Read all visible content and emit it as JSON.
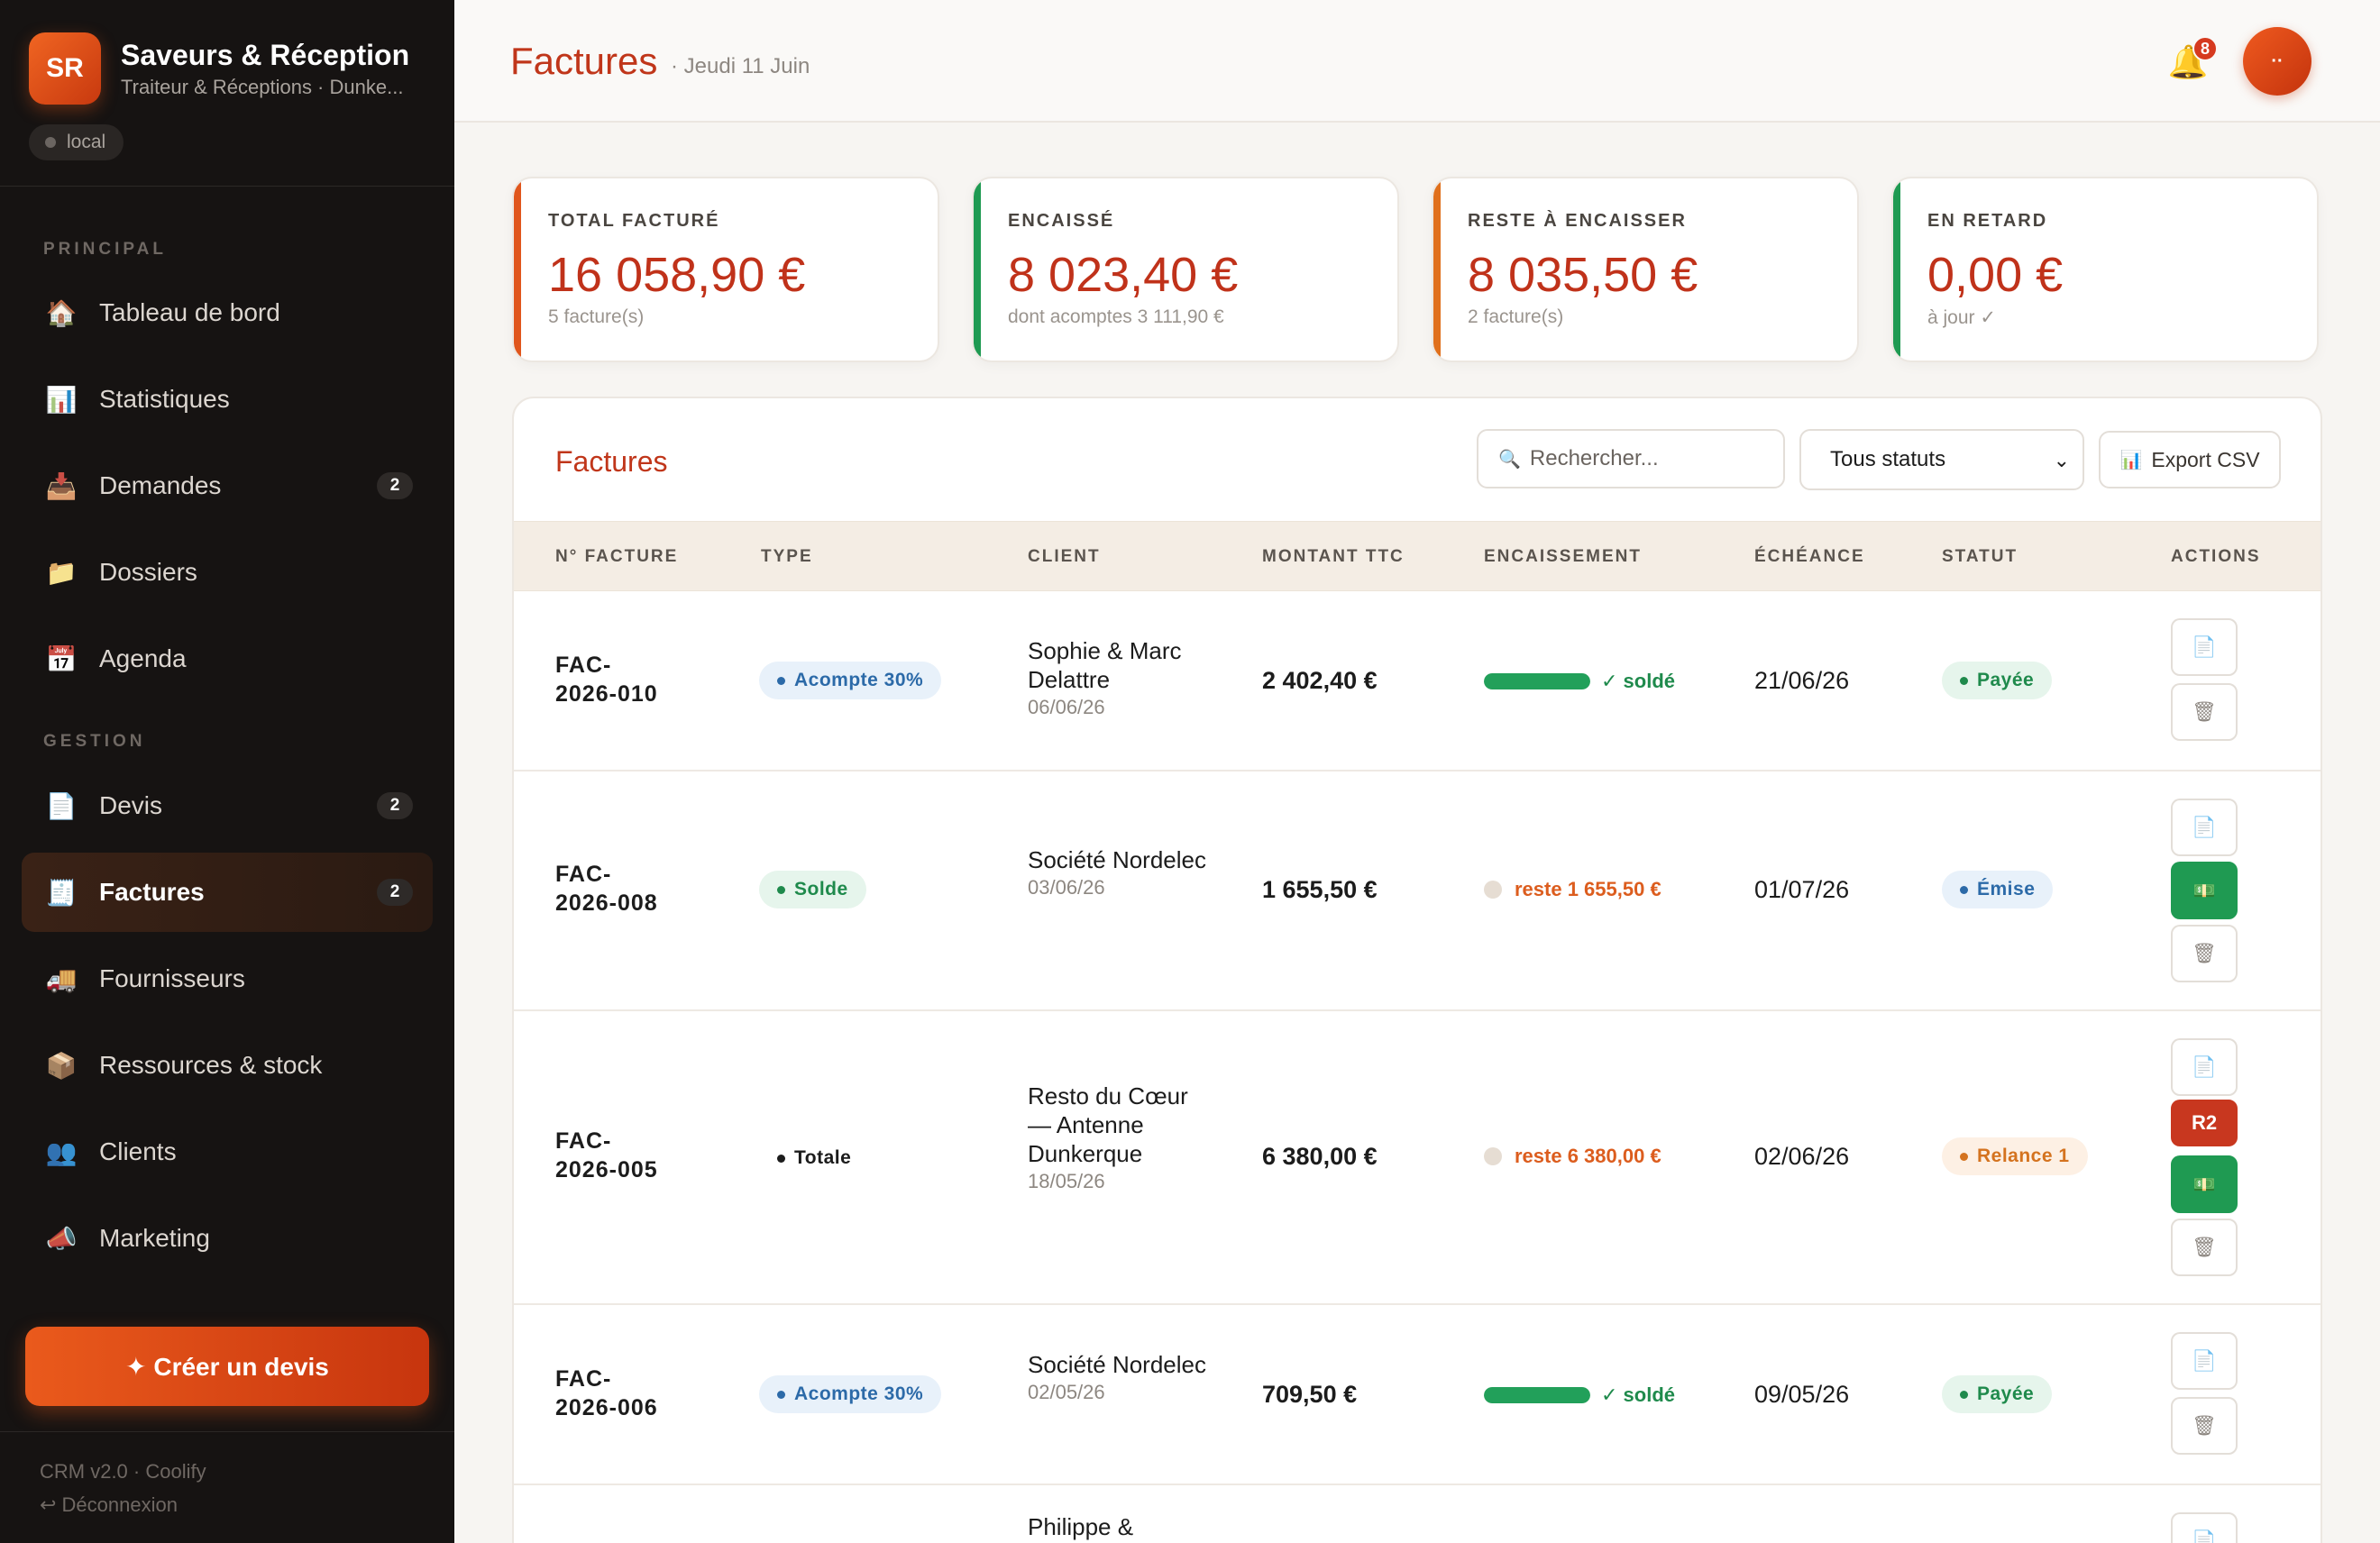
{
  "brand": {
    "logo": "SR",
    "title": "Saveurs & Réception",
    "subtitle": "Traiteur & Réceptions · Dunke...",
    "env": "local"
  },
  "sidebar": {
    "section_principal": "PRINCIPAL",
    "section_gestion": "GESTION",
    "items": [
      {
        "label": "Tableau de bord",
        "icon": "🏠",
        "badge": ""
      },
      {
        "label": "Statistiques",
        "icon": "📊",
        "badge": ""
      },
      {
        "label": "Demandes",
        "icon": "📥",
        "badge": "2"
      },
      {
        "label": "Dossiers",
        "icon": "📁",
        "badge": ""
      },
      {
        "label": "Agenda",
        "icon": "📅",
        "badge": ""
      },
      {
        "label": "Devis",
        "icon": "📄",
        "badge": "2"
      },
      {
        "label": "Factures",
        "icon": "🧾",
        "badge": "2"
      },
      {
        "label": "Fournisseurs",
        "icon": "🚚",
        "badge": ""
      },
      {
        "label": "Ressources & stock",
        "icon": "📦",
        "badge": ""
      },
      {
        "label": "Clients",
        "icon": "👥",
        "badge": ""
      },
      {
        "label": "Marketing",
        "icon": "📣",
        "badge": ""
      }
    ],
    "create_label": "✦ Créer un devis",
    "footer_version": "CRM v2.0 · Coolify",
    "footer_logout": "↩ Déconnexion"
  },
  "header": {
    "title": "Factures",
    "date": "· Jeudi 11 Juin",
    "notif_count": "8",
    "avatar": "··",
    "bell_icon": "🔔"
  },
  "kpis": [
    {
      "label": "TOTAL FACTURÉ",
      "value": "16 058,90 €",
      "sub": "5 facture(s)",
      "color": "#e0561c"
    },
    {
      "label": "ENCAISSÉ",
      "value": "8 023,40 €",
      "sub": "dont acomptes 3 111,90 €",
      "color": "#1f9a52"
    },
    {
      "label": "RESTE À ENCAISSER",
      "value": "8 035,50 €",
      "sub": "2 facture(s)",
      "color": "#e0701c"
    },
    {
      "label": "EN RETARD",
      "value": "0,00 €",
      "sub": "à jour ✓",
      "color": "#1f9a52"
    }
  ],
  "table": {
    "title": "Factures",
    "search_placeholder": "Rechercher...",
    "search_icon": "🔍",
    "status_filter": "Tous statuts",
    "export_label": "Export CSV",
    "export_icon": "📊",
    "columns": [
      "N° FACTURE",
      "TYPE",
      "CLIENT",
      "MONTANT TTC",
      "ENCAISSEMENT",
      "ÉCHÉANCE",
      "STATUT",
      "ACTIONS"
    ],
    "rows": [
      {
        "num1": "FAC-",
        "num2": "2026-010",
        "type": "Acompte 30%",
        "client": "Sophie & Marc Delattre",
        "client_date": "06/06/26",
        "amount": "2 402,40 €",
        "payment": "✓ soldé",
        "paid_fraction": 1,
        "due": "21/06/26",
        "status": "Payée"
      },
      {
        "num1": "FAC-",
        "num2": "2026-008",
        "type": "Solde",
        "client": "Société Nordelec",
        "client_date": "03/06/26",
        "amount": "1 655,50 €",
        "payment": "reste 1 655,50 €",
        "paid_fraction": 0,
        "due": "01/07/26",
        "status": "Émise"
      },
      {
        "num1": "FAC-",
        "num2": "2026-005",
        "type": "Totale",
        "client": "Resto du Cœur — Antenne Dunkerque",
        "client_date": "18/05/26",
        "amount": "6 380,00 €",
        "payment": "reste 6 380,00 €",
        "paid_fraction": 0,
        "due": "02/06/26",
        "status": "Relance 1",
        "reminder": "R2"
      },
      {
        "num1": "FAC-",
        "num2": "2026-006",
        "type": "Acompte 30%",
        "client": "Société Nordelec",
        "client_date": "02/05/26",
        "amount": "709,50 €",
        "payment": "✓ soldé",
        "paid_fraction": 1,
        "due": "09/05/26",
        "status": "Payée"
      },
      {
        "client": "Philippe &"
      }
    ],
    "action_icons": {
      "pdf": "📄",
      "delete": "🗑",
      "encaisser": "💵"
    }
  }
}
